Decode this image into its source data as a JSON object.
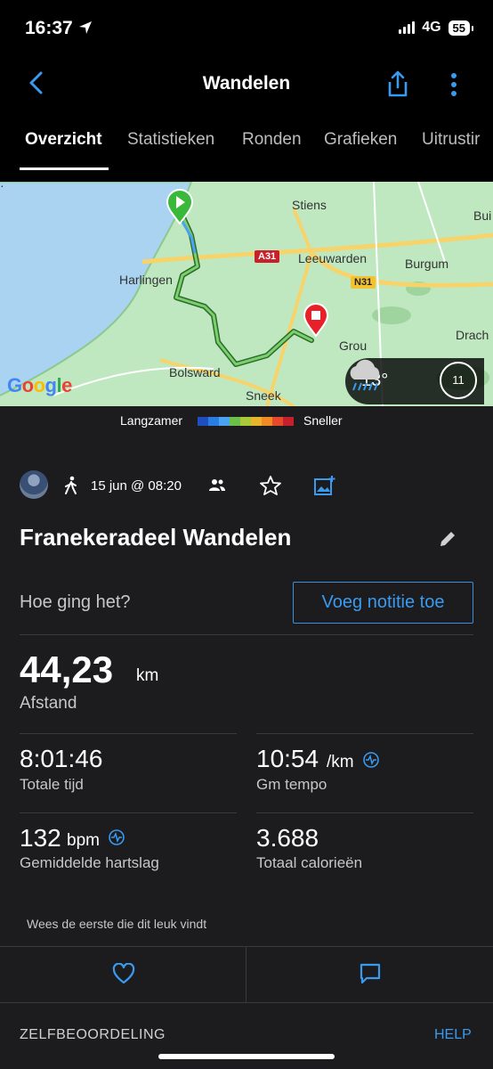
{
  "status_bar": {
    "time": "16:37",
    "network": "4G",
    "battery": "55"
  },
  "nav": {
    "title": "Wandelen"
  },
  "tabs": [
    {
      "label": "Overzicht",
      "active": true
    },
    {
      "label": "Statistieken"
    },
    {
      "label": "Ronden"
    },
    {
      "label": "Grafieken"
    },
    {
      "label": "Uitrustir"
    }
  ],
  "map": {
    "places": [
      "Stiens",
      "Harlingen",
      "Leeuwarden",
      "Burgum",
      "Bolsward",
      "Sneek",
      "Grou",
      "Drach",
      "Bui"
    ],
    "roads": [
      "A31",
      "N31"
    ],
    "provider": "Google",
    "weather": {
      "temp": "13°",
      "wind": "11"
    }
  },
  "legend": {
    "slow": "Langzamer",
    "fast": "Sneller",
    "colors": [
      "#1f4fbf",
      "#2a7de1",
      "#4aa3f0",
      "#6cc04a",
      "#a9c83a",
      "#e6b52c",
      "#f08a24",
      "#e64a2a",
      "#c8202a"
    ]
  },
  "activity": {
    "date": "15 jun @ 08:20",
    "title": "Franekeradeel Wandelen",
    "how_prompt": "Hoe ging het?",
    "note_button": "Voeg notitie toe",
    "distance": {
      "value": "44,23",
      "unit": "km",
      "label": "Afstand"
    },
    "total_time": {
      "value": "8:01:46",
      "label": "Totale tijd"
    },
    "pace": {
      "value": "10:54",
      "unit": "/km",
      "label": "Gm tempo"
    },
    "heart_rate": {
      "value": "132",
      "unit": "bpm",
      "label": "Gemiddelde hartslag"
    },
    "calories": {
      "value": "3.688",
      "label": "Totaal calorieën"
    },
    "likes_text": "Wees de eerste die dit leuk vindt"
  },
  "footer": {
    "section": "ZELFBEOORDELING",
    "help": "HELP"
  }
}
